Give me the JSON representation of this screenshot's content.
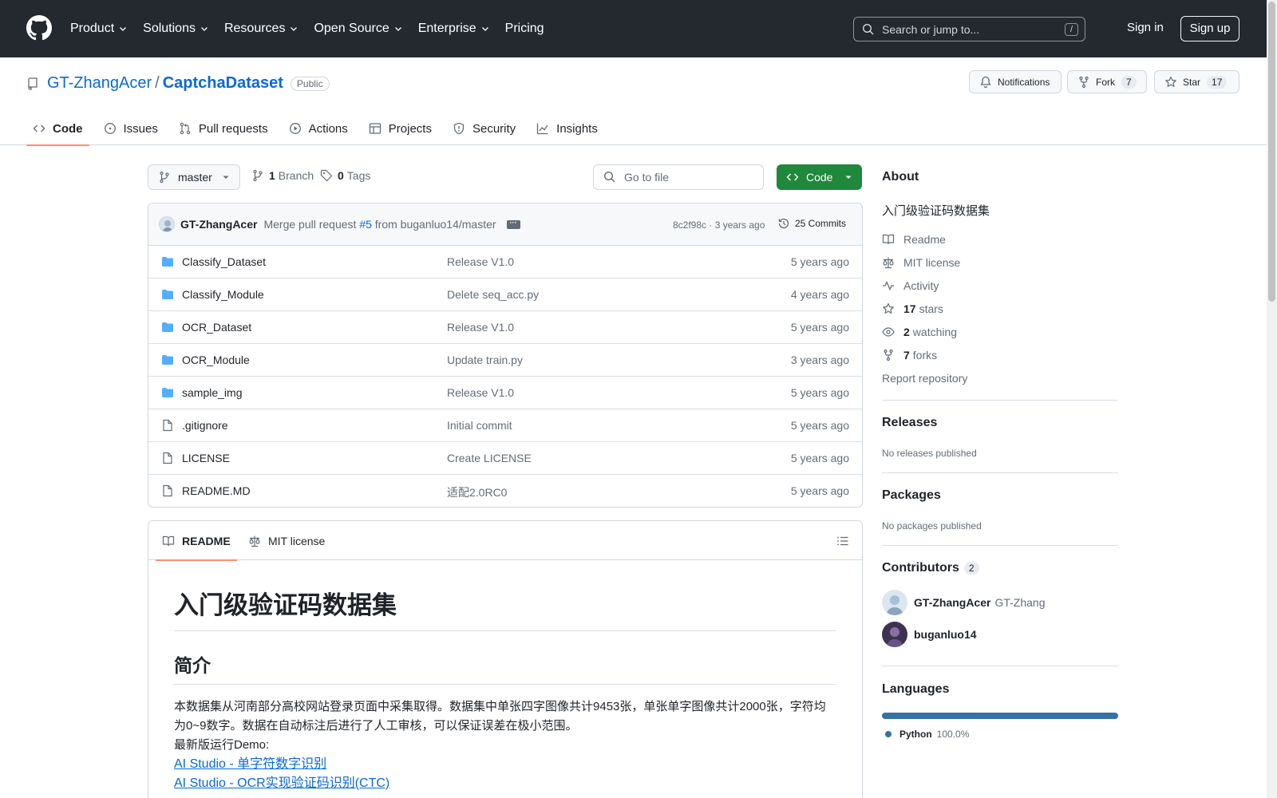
{
  "header": {
    "nav": [
      {
        "label": "Product",
        "has_menu": true
      },
      {
        "label": "Solutions",
        "has_menu": true
      },
      {
        "label": "Resources",
        "has_menu": true
      },
      {
        "label": "Open Source",
        "has_menu": true
      },
      {
        "label": "Enterprise",
        "has_menu": true
      },
      {
        "label": "Pricing",
        "has_menu": false
      }
    ],
    "search_placeholder": "Search or jump to...",
    "search_shortcut": "/",
    "sign_in": "Sign in",
    "sign_up": "Sign up"
  },
  "repo": {
    "owner": "GT-ZhangAcer",
    "separator": "/",
    "name": "CaptchaDataset",
    "visibility": "Public",
    "notifications_label": "Notifications",
    "fork_label": "Fork",
    "fork_count": "7",
    "star_label": "Star",
    "star_count": "17",
    "tabs": [
      {
        "label": "Code",
        "icon": "code-icon",
        "active": true
      },
      {
        "label": "Issues",
        "icon": "issue-icon",
        "active": false
      },
      {
        "label": "Pull requests",
        "icon": "pull-request-icon",
        "active": false
      },
      {
        "label": "Actions",
        "icon": "play-icon",
        "active": false
      },
      {
        "label": "Projects",
        "icon": "table-icon",
        "active": false
      },
      {
        "label": "Security",
        "icon": "shield-icon",
        "active": false
      },
      {
        "label": "Insights",
        "icon": "graph-icon",
        "active": false
      }
    ]
  },
  "toolbar": {
    "branch": "master",
    "branch_count": "1",
    "branch_label": "Branch",
    "tag_count": "0",
    "tag_label": "Tags",
    "goto_placeholder": "Go to file",
    "code_label": "Code"
  },
  "latest_commit": {
    "author": "GT-ZhangAcer",
    "message_prefix": "Merge pull request",
    "pr": "#5",
    "message_suffix": "from buganluo14/master",
    "sha_time": "8c2f98c · 3 years ago",
    "commits_label": "25 Commits"
  },
  "files": [
    {
      "name": "Classify_Dataset",
      "type": "dir",
      "message": "Release V1.0",
      "age": "5 years ago"
    },
    {
      "name": "Classify_Module",
      "type": "dir",
      "message": "Delete seq_acc.py",
      "age": "4 years ago"
    },
    {
      "name": "OCR_Dataset",
      "type": "dir",
      "message": "Release V1.0",
      "age": "5 years ago"
    },
    {
      "name": "OCR_Module",
      "type": "dir",
      "message": "Update train.py",
      "age": "3 years ago"
    },
    {
      "name": "sample_img",
      "type": "dir",
      "message": "Release V1.0",
      "age": "5 years ago"
    },
    {
      "name": ".gitignore",
      "type": "file",
      "message": "Initial commit",
      "age": "5 years ago"
    },
    {
      "name": "LICENSE",
      "type": "file",
      "message": "Create LICENSE",
      "age": "5 years ago"
    },
    {
      "name": "README.MD",
      "type": "file",
      "message": "适配2.0RC0",
      "age": "5 years ago"
    }
  ],
  "readme": {
    "tab_readme": "README",
    "tab_license": "MIT license",
    "h1": "入门级验证码数据集",
    "h2": "简介",
    "para": "本数据集从河南部分高校网站登录页面中采集取得。数据集中单张四字图像共计9453张，单张单字图像共计2000张，字符均为0~9数字。数据在自动标注后进行了人工审核，可以保证误差在极小范围。",
    "demo_label": "最新版运行Demo:",
    "link1": "AI Studio - 单字符数字识别",
    "link2": "AI Studio - OCR实现验证码识别(CTC)"
  },
  "sidebar": {
    "about_title": "About",
    "description": "入门级验证码数据集",
    "readme": "Readme",
    "license": "MIT license",
    "activity": "Activity",
    "stars_count": "17",
    "stars_label": "stars",
    "watching_count": "2",
    "watching_label": "watching",
    "forks_count": "7",
    "forks_label": "forks",
    "report": "Report repository",
    "releases_title": "Releases",
    "releases_empty": "No releases published",
    "packages_title": "Packages",
    "packages_empty": "No packages published",
    "contributors_title": "Contributors",
    "contributors_count": "2",
    "contributors": [
      {
        "login": "GT-ZhangAcer",
        "name": "GT-Zhang"
      },
      {
        "login": "buganluo14",
        "name": ""
      }
    ],
    "languages_title": "Languages",
    "language": {
      "name": "Python",
      "percent": "100.0%",
      "fraction": 1.0,
      "color": "#3572A5"
    }
  },
  "colors": {
    "header_bg": "#24292f",
    "link": "#0969da",
    "primary_button": "#1f883d",
    "active_tab_underline": "#fd8c73"
  }
}
